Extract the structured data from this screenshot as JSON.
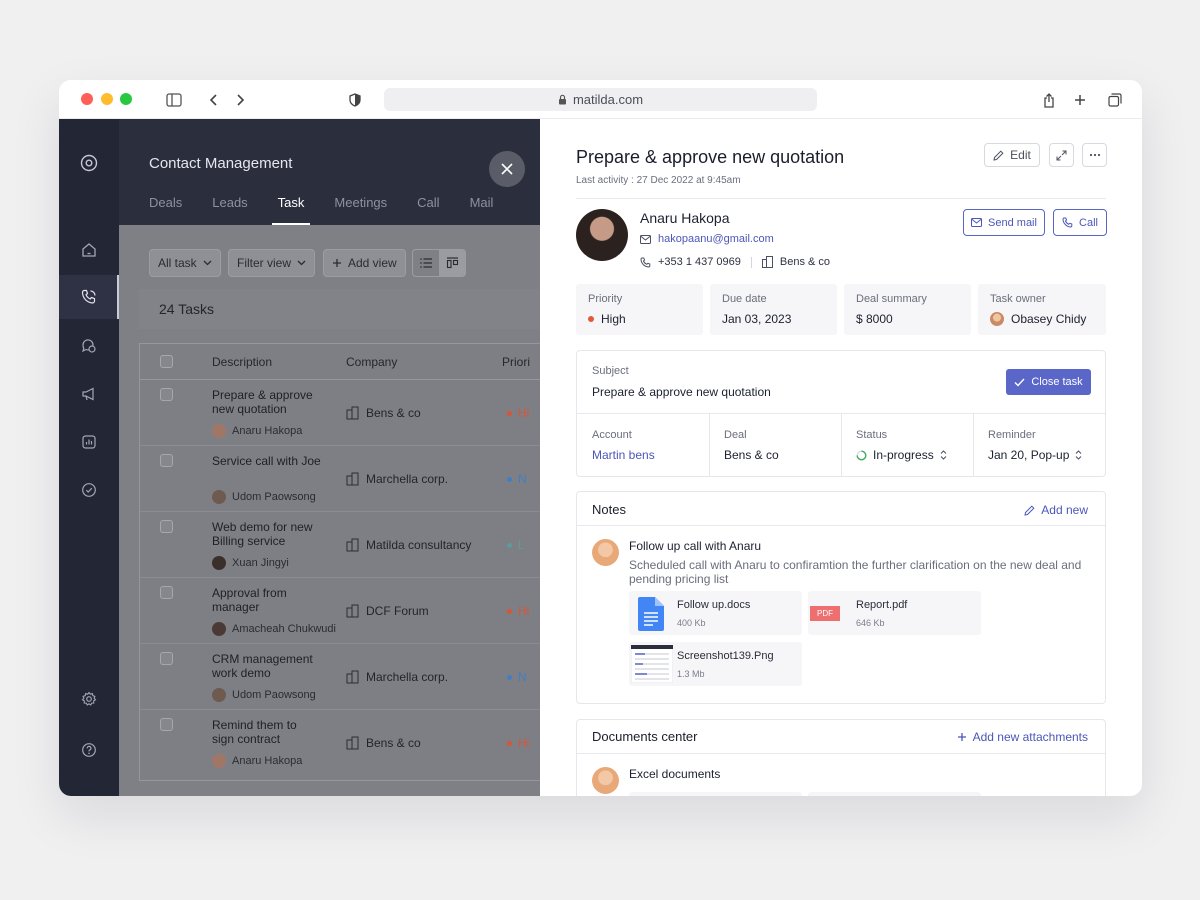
{
  "browser": {
    "url": "matilda.com"
  },
  "app": {
    "title": "Contact Management",
    "tabs": [
      "Deals",
      "Leads",
      "Task",
      "Meetings",
      "Call",
      "Mail"
    ],
    "active_tab": "Task"
  },
  "toolbar": {
    "all_task": "All task",
    "filter_view": "Filter view",
    "add_view": "Add view"
  },
  "task_count": "24 Tasks",
  "table": {
    "columns": [
      "Description",
      "Company",
      "Priori"
    ],
    "rows": [
      {
        "description": "Prepare & approve new quotation",
        "assignee": "Anaru Hakopa",
        "company": "Bens & co",
        "priority": "Hi",
        "priority_color": "#d8553a"
      },
      {
        "description": "Service call with Joe",
        "assignee": "Udom Paowsong",
        "company": "Marchella corp.",
        "priority": "N",
        "priority_color": "#3f7fc4"
      },
      {
        "description": "Web demo for new Billing service",
        "assignee": "Xuan Jingyi",
        "company": "Matilda consultancy",
        "priority": "L",
        "priority_color": "#5f9a9c"
      },
      {
        "description": "Approval from manager",
        "assignee": "Amacheah Chukwudi",
        "company": "DCF Forum",
        "priority": "Hi",
        "priority_color": "#d8553a"
      },
      {
        "description": "CRM management work demo",
        "assignee": "Udom Paowsong",
        "company": "Marchella corp.",
        "priority": "N",
        "priority_color": "#3f7fc4"
      },
      {
        "description": "Remind them to sign contract",
        "assignee": "Anaru Hakopa",
        "company": "Bens & co",
        "priority": "Hi",
        "priority_color": "#d8553a"
      }
    ]
  },
  "panel": {
    "title": "Prepare & approve new quotation",
    "last_activity": "Last activity :  27 Dec 2022 at 9:45am",
    "edit_label": "Edit",
    "contact": {
      "name": "Anaru Hakopa",
      "email": "hakopaanu@gmail.com",
      "phone": "+353 1 437 0969",
      "company": "Bens & co"
    },
    "send_mail_label": "Send mail",
    "call_label": "Call",
    "info": [
      {
        "label": "Priority",
        "value": "High"
      },
      {
        "label": "Due date",
        "value": "Jan 03, 2023"
      },
      {
        "label": "Deal summary",
        "value": "$ 8000"
      },
      {
        "label": "Task owner",
        "value": "Obasey Chidy"
      }
    ],
    "subject_label": "Subject",
    "subject": "Prepare & approve new quotation",
    "close_task_label": "Close task",
    "details": [
      {
        "label": "Account",
        "value": "Martin bens"
      },
      {
        "label": "Deal",
        "value": "Bens & co"
      },
      {
        "label": "Status",
        "value": "In-progress"
      },
      {
        "label": "Reminder",
        "value": "Jan 20, Pop-up"
      }
    ],
    "notes": {
      "title": "Notes",
      "add_label": "Add new",
      "note_title": "Follow up call with Anaru",
      "note_body": "Scheduled call with Anaru to confiramtion the further clarification on the new deal and pending pricing list",
      "files": [
        {
          "name": "Follow up.docs",
          "size": "400 Kb",
          "icon": "google-doc-icon"
        },
        {
          "name": "Report.pdf",
          "size": "646 Kb",
          "icon": "pdf-icon",
          "badge": "PDF"
        },
        {
          "name": "Screenshot139.Png",
          "size": "1.3 Mb",
          "icon": "screenshot-thumbnail"
        }
      ]
    },
    "documents": {
      "title": "Documents center",
      "add_label": "Add new attachments",
      "first_title": "Excel documents"
    }
  },
  "colors": {
    "accent": "#5b66c9",
    "sidebar": "#232635",
    "high_priority": "#e05a3a",
    "status_green": "#3fae5a"
  }
}
